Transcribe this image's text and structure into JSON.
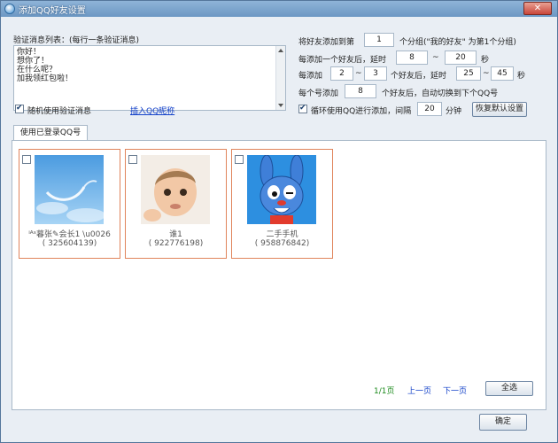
{
  "window": {
    "title": "添加QQ好友设置",
    "close_label": "✕"
  },
  "verify": {
    "label": "验证消息列表：(每行一条验证消息)",
    "messages": [
      "你好！",
      "想你了！",
      "在什么呢？",
      "加我领红包啦！"
    ],
    "random_checked": true,
    "random_label": "随机使用验证消息",
    "insert_nickname_link": "插入QQ昵称"
  },
  "settings": {
    "group_prefix": "将好友添加到第",
    "group_value": "1",
    "group_suffix": "个分组(\"我的好友\" 为第1个分组)",
    "delay_prefix": "每添加一个好友后，延时",
    "delay_min": "8",
    "delay_sep": "~",
    "delay_max": "20",
    "delay_unit": "秒",
    "batch_prefix": "每添加",
    "batch_min": "2",
    "batch_sep": "~",
    "batch_max": "3",
    "batch_mid": "个好友后，延时",
    "batch_delay_min": "25",
    "batch_delay_sep": "~",
    "batch_delay_max": "45",
    "batch_unit": "秒",
    "switch_prefix": "每个号添加",
    "switch_value": "8",
    "switch_suffix": "个好友后，自动切换到下个QQ号",
    "loop_checked": true,
    "loop_label": "循环使用QQ进行添加，间隔",
    "loop_interval": "20",
    "loop_unit": "分钟",
    "reset_button": "恢复默认设置"
  },
  "tab": {
    "label": "使用已登录QQ号"
  },
  "accounts": [
    {
      "name": "ⁱᴬˢ暮张✎会长1 \\u0026",
      "qq": "( 325604139)",
      "avatar_icon": "sky-swirl-avatar"
    },
    {
      "name": "谁1",
      "qq": "( 922776198)",
      "avatar_icon": "baby-photo-avatar"
    },
    {
      "name": "二手手机",
      "qq": "( 958876842)",
      "avatar_icon": "blue-rabbit-avatar"
    }
  ],
  "pager": {
    "current": "1/1页",
    "prev": "上一页",
    "next": "下一页",
    "select_all": "全选"
  },
  "footer": {
    "ok_button": "确定"
  }
}
